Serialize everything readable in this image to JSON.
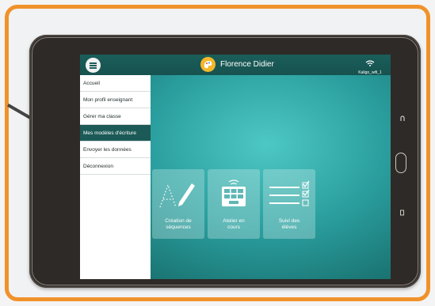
{
  "header": {
    "user_name": "Florence Didier",
    "wifi_name": "Kaligo_wifi_1"
  },
  "sidebar": {
    "items": [
      {
        "label": "Accueil",
        "active": false
      },
      {
        "label": "Mon profil enseignant",
        "active": false
      },
      {
        "label": "Gérer ma classe",
        "active": false
      },
      {
        "label": "Mes modèles d'écriture",
        "active": true
      },
      {
        "label": "Envoyer les données",
        "active": false
      },
      {
        "label": "Déconnexion",
        "active": false
      }
    ]
  },
  "tiles": [
    {
      "label_line1": "Création de",
      "label_line2": "séquences",
      "icon": "pen-trace-icon"
    },
    {
      "label_line1": "Atelier en",
      "label_line2": "cours",
      "icon": "tablet-keyboard-icon"
    },
    {
      "label_line1": "Suivi des",
      "label_line2": "élèves",
      "icon": "checklist-icon"
    }
  ],
  "colors": {
    "frame": "#f0922b",
    "topbar": "#1a5e5a",
    "active_item": "#1c5a57",
    "avatar": "#f5b82a"
  }
}
